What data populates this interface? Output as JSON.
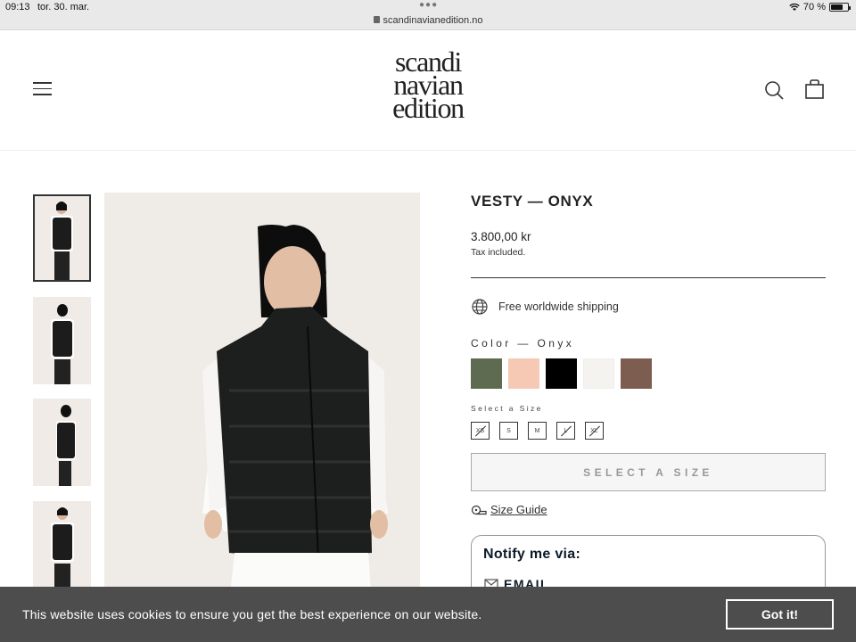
{
  "status_bar": {
    "time": "09:13",
    "date": "tor. 30. mar.",
    "url": "scandinavianedition.no",
    "battery": "70 %",
    "battery_level": 0.7
  },
  "header": {
    "logo_lines": [
      "scandi",
      "navian",
      "edition"
    ]
  },
  "product": {
    "title": "VESTY — ONYX",
    "price": "3.800,00 kr",
    "tax_note": "Tax included.",
    "shipping": "Free worldwide shipping",
    "color_label": "Color — Onyx",
    "swatch_colors": [
      "#5f6b50",
      "#f5c9b4",
      "#000000",
      "#f5f3ef",
      "#7d5d50"
    ],
    "size_label": "Select a Size",
    "sizes": [
      {
        "label": "XS",
        "sold_out": true
      },
      {
        "label": "S",
        "sold_out": false
      },
      {
        "label": "M",
        "sold_out": false
      },
      {
        "label": "L",
        "sold_out": true
      },
      {
        "label": "XL",
        "sold_out": true
      }
    ],
    "select_button": "SELECT A SIZE",
    "size_guide": "Size Guide"
  },
  "notify": {
    "title": "Notify me via:",
    "email": "EMAIL"
  },
  "cookie": {
    "text": "This website uses cookies to ensure you get the best experience on our website.",
    "button": "Got it!"
  }
}
